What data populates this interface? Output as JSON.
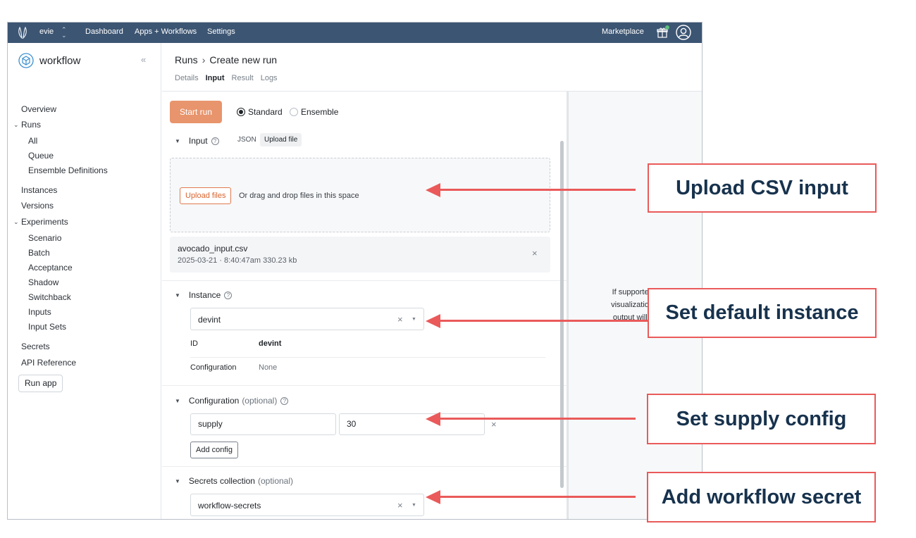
{
  "topbar": {
    "org": "evie",
    "nav": [
      "Dashboard",
      "Apps + Workflows",
      "Settings"
    ],
    "marketplace": "Marketplace",
    "icons": {
      "logo": "leaf-logo-icon",
      "gift": "gift-icon",
      "user": "user-avatar-icon"
    },
    "colors": {
      "bg": "#3c5573",
      "notification": "#5cc07a"
    }
  },
  "sidebar": {
    "app_name": "workflow",
    "collapse": "«",
    "items": {
      "overview": "Overview",
      "runs": "Runs",
      "runs_all": "All",
      "runs_queue": "Queue",
      "runs_ensemble": "Ensemble Definitions",
      "instances": "Instances",
      "versions": "Versions",
      "experiments": "Experiments",
      "exp_scenario": "Scenario",
      "exp_batch": "Batch",
      "exp_acceptance": "Acceptance",
      "exp_shadow": "Shadow",
      "exp_switchback": "Switchback",
      "exp_inputs": "Inputs",
      "exp_input_sets": "Input Sets",
      "secrets": "Secrets",
      "api_reference": "API Reference"
    },
    "run_app": "Run app"
  },
  "header": {
    "crumb_parent": "Runs",
    "crumb_sep": "›",
    "crumb_current": "Create new run",
    "tabs": [
      "Details",
      "Input",
      "Result",
      "Logs"
    ],
    "active_tab": "Input"
  },
  "form": {
    "start_run": "Start run",
    "run_type": {
      "standard": "Standard",
      "ensemble": "Ensemble",
      "selected": "Standard"
    },
    "input": {
      "title": "Input",
      "json_tab": "JSON",
      "upload_tab": "Upload file",
      "upload_button": "Upload files",
      "drop_text": "Or drag and drop files in this space",
      "file_name": "avocado_input.csv",
      "file_meta": "2025-03-21 · 8:40:47am   330.23 kb"
    },
    "instance": {
      "title": "Instance",
      "value": "devint",
      "id_label": "ID",
      "id_value": "devint",
      "config_label": "Configuration",
      "config_value": "None"
    },
    "configuration": {
      "title": "Configuration",
      "optional": "(optional)",
      "key": "supply",
      "value": "30",
      "add": "Add config"
    },
    "secrets": {
      "title": "Secrets collection",
      "optional": "(optional)",
      "value": "workflow-secrets"
    }
  },
  "right_panel": {
    "line1": "If supported by",
    "line2": "visualization for",
    "line3": "output will app"
  },
  "annotations": {
    "upload": "Upload CSV input",
    "instance": "Set default instance",
    "config": "Set supply config",
    "secret": "Add workflow secret",
    "color": "#ea5a5a"
  }
}
